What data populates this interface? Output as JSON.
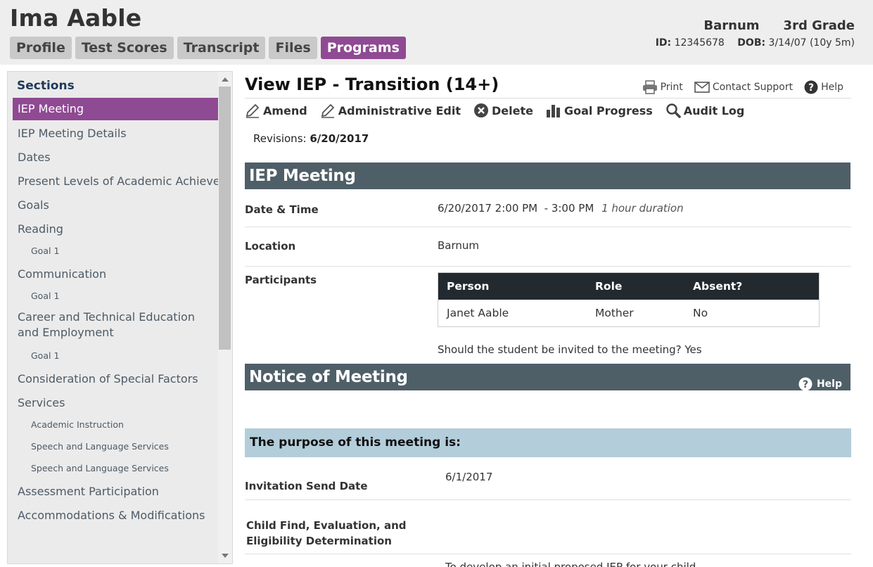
{
  "student": {
    "name": "Ima Aable",
    "school": "Barnum",
    "grade": "3rd Grade",
    "id_label": "ID:",
    "id_value": "12345678",
    "dob_label": "DOB:",
    "dob_value": "3/14/07 (10y 5m)"
  },
  "tabs": [
    {
      "label": "Profile"
    },
    {
      "label": "Test Scores"
    },
    {
      "label": "Transcript"
    },
    {
      "label": "Files"
    },
    {
      "label": "Programs",
      "active": true
    }
  ],
  "sidebar": {
    "title": "Sections",
    "items": [
      {
        "label": "IEP Meeting",
        "active": true
      },
      {
        "label": "IEP Meeting Details"
      },
      {
        "label": "Dates"
      },
      {
        "label": "Present Levels of Academic Achievement"
      },
      {
        "label": "Goals"
      },
      {
        "label": "Reading"
      },
      {
        "label": "Goal 1"
      },
      {
        "label": "Communication"
      },
      {
        "label": "Goal 1"
      },
      {
        "label": "Career and Technical Education and Employment"
      },
      {
        "label": "Goal 1"
      },
      {
        "label": "Consideration of Special Factors"
      },
      {
        "label": "Services"
      },
      {
        "label": "Academic Instruction"
      },
      {
        "label": "Speech and Language Services"
      },
      {
        "label": "Speech and Language Services"
      },
      {
        "label": "Assessment Participation"
      },
      {
        "label": "Accommodations & Modifications"
      }
    ]
  },
  "main": {
    "title": "View IEP - Transition (14+)",
    "top_links": {
      "print": "Print",
      "contact": "Contact Support",
      "help": "Help"
    },
    "actions": {
      "amend": "Amend",
      "admin_edit": "Administrative Edit",
      "delete": "Delete",
      "goal_progress": "Goal Progress",
      "audit_log": "Audit Log"
    },
    "revisions_label": "Revisions:",
    "revisions_value": "6/20/2017",
    "meeting_section": {
      "title": "IEP Meeting",
      "datetime_label": "Date & Time",
      "datetime_value": "6/20/2017 2:00 PM  - 3:00 PM",
      "duration": "1 hour duration",
      "location_label": "Location",
      "location_value": "Barnum",
      "participants_label": "Participants",
      "participants_table": {
        "headers": [
          "Person",
          "Role",
          "Absent?"
        ],
        "rows": [
          [
            "Janet Aable",
            "Mother",
            "No"
          ]
        ]
      },
      "invite_question": "Should the student be invited to the meeting? Yes"
    },
    "notice_section": {
      "title": "Notice of Meeting",
      "help": "Help",
      "purpose_heading": "The purpose of this meeting is:",
      "invitation_label": "Invitation Send Date",
      "invitation_value": "6/1/2017",
      "child_find_label_1": "Child Find, Evaluation, and",
      "child_find_label_2": "Eligibility Determination",
      "cut_text": "To develop an initial proposed IEP for your child"
    }
  }
}
